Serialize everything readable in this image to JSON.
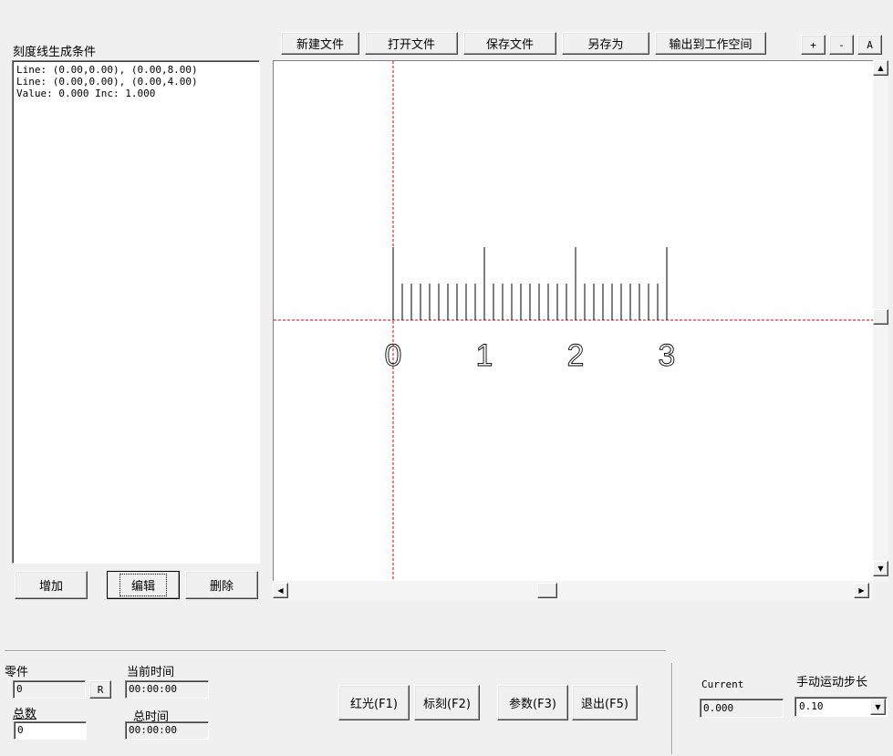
{
  "left_panel": {
    "title": "刻度线生成条件",
    "conditions": [
      "Line: (0.00,0.00), (0.00,8.00)",
      "Line: (0.00,0.00), (0.00,4.00)",
      "Value: 0.000 Inc: 1.000"
    ],
    "add_label": "增加",
    "edit_label": "编辑",
    "delete_label": "删除"
  },
  "toolbar": {
    "new_file": "新建文件",
    "open_file": "打开文件",
    "save_file": "保存文件",
    "save_as": "另存为",
    "export_workspace": "输出到工作空间",
    "zoom_in": "+",
    "zoom_out": "-",
    "auto": "A"
  },
  "canvas": {
    "scale_labels": [
      "0",
      "1",
      "2",
      "3"
    ],
    "grid_color": "#e00000"
  },
  "status": {
    "parts_label": "零件",
    "parts_value": "0",
    "reset_label": "R",
    "total_label": "总数",
    "total_value": "0",
    "current_time_label": "当前时间",
    "current_time_value": "00:00:00",
    "total_time_label": "总时间",
    "total_time_value": "00:00:00"
  },
  "actions": {
    "red_light": "红光(F1)",
    "mark": "标刻(F2)",
    "params": "参数(F3)",
    "exit": "退出(F5)"
  },
  "motion": {
    "current_label": "Current",
    "current_value": "0.000",
    "step_label": "手动运动步长",
    "step_value": "0.10"
  }
}
